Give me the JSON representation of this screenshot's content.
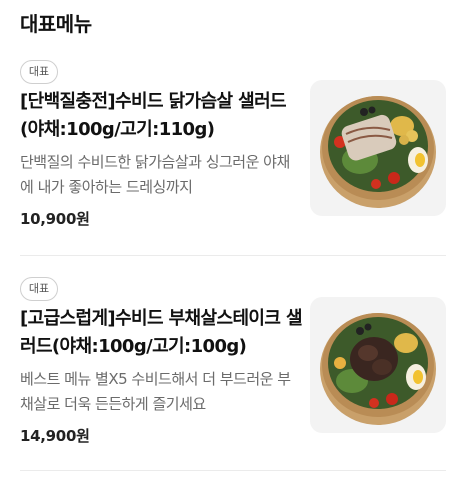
{
  "section": {
    "title": "대표메뉴"
  },
  "menu_items": [
    {
      "badge": "대표",
      "name": "[단백질충전]수비드 닭가슴살 샐러드(야채:100g/고기:110g)",
      "description": "단백질의 수비드한 닭가슴살과 싱그러운 야채에 내가 좋아하는 드레싱까지",
      "price": "10,900원",
      "image": "chicken-breast-salad-bowl"
    },
    {
      "badge": "대표",
      "name": "[고급스럽게]수비드 부채살스테이크 샐러드(야채:100g/고기:100g)",
      "description": "베스트 메뉴 별X5 수비드해서 더 부드러운 부채살로 더욱 든든하게 즐기세요",
      "price": "14,900원",
      "image": "steak-salad-bowl"
    }
  ]
}
